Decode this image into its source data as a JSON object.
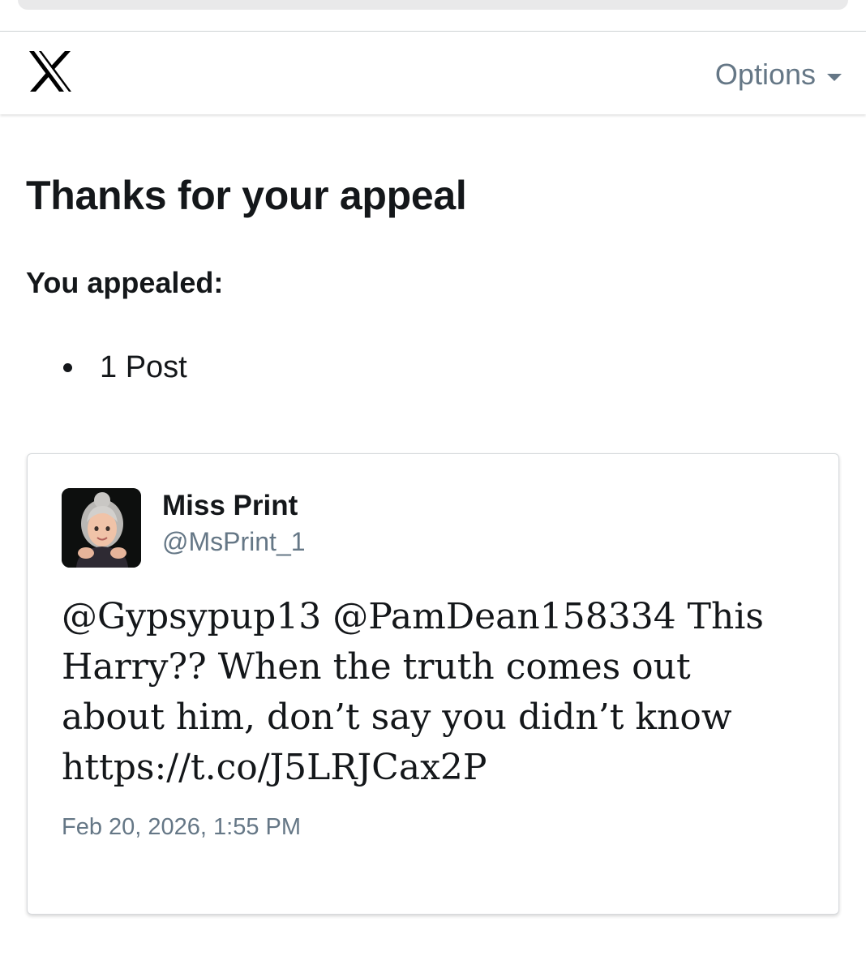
{
  "header": {
    "logo_icon": "x-logo-icon",
    "options_label": "Options"
  },
  "main": {
    "title": "Thanks for your appeal",
    "subtitle": "You appealed:",
    "appealed_items": [
      "1 Post"
    ]
  },
  "post": {
    "author_name": "Miss Print",
    "author_handle": "@MsPrint_1",
    "avatar_icon": "memoji-avatar-icon",
    "text": "@Gypsypup13 @PamDean158334 This Harry?? When the truth comes out about him, don’t say you didn’t know https://t.co/J5LRJCax2P",
    "date": "Feb 20, 2026, 1:55 PM"
  },
  "colors": {
    "text_primary": "#14171a",
    "text_secondary": "#657786",
    "border": "#d6d9dc"
  }
}
